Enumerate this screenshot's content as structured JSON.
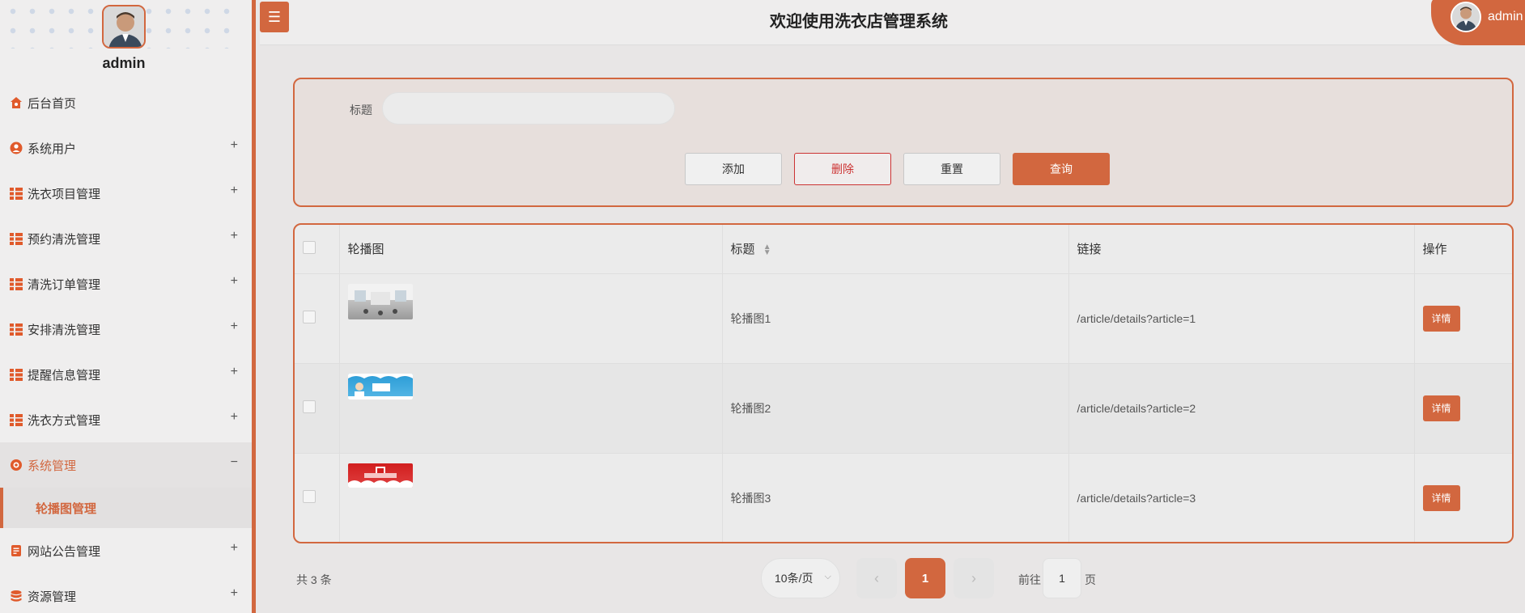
{
  "sidebar": {
    "username": "admin",
    "items": [
      {
        "label": "后台首页",
        "icon": "home-icon",
        "expand": ""
      },
      {
        "label": "系统用户",
        "icon": "user-icon",
        "expand": "+"
      },
      {
        "label": "洗衣项目管理",
        "icon": "grid-icon",
        "expand": "+"
      },
      {
        "label": "预约清洗管理",
        "icon": "grid-icon",
        "expand": "+"
      },
      {
        "label": "清洗订单管理",
        "icon": "grid-icon",
        "expand": "+"
      },
      {
        "label": "安排清洗管理",
        "icon": "grid-icon",
        "expand": "+"
      },
      {
        "label": "提醒信息管理",
        "icon": "grid-icon",
        "expand": "+"
      },
      {
        "label": "洗衣方式管理",
        "icon": "grid-icon",
        "expand": "+"
      },
      {
        "label": "系统管理",
        "icon": "gear-icon",
        "expand": "−"
      },
      {
        "label": "网站公告管理",
        "icon": "document-icon",
        "expand": "+"
      },
      {
        "label": "资源管理",
        "icon": "database-icon",
        "expand": "+"
      }
    ],
    "submenu_active": "轮播图管理",
    "accent": "#d2673f"
  },
  "header": {
    "title": "欢迎使用洗衣店管理系统",
    "toggle_icon": "☰",
    "username": "admin"
  },
  "search": {
    "label": "标题",
    "value": "",
    "buttons": {
      "add": "添加",
      "delete": "删除",
      "reset": "重置",
      "search": "查询"
    }
  },
  "table": {
    "columns": [
      "轮播图",
      "标题",
      "链接",
      "操作"
    ],
    "rows": [
      {
        "title": "轮播图1",
        "link": "/article/details?article=1",
        "action": "详情"
      },
      {
        "title": "轮播图2",
        "link": "/article/details?article=2",
        "action": "详情"
      },
      {
        "title": "轮播图3",
        "link": "/article/details?article=3",
        "action": "详情"
      }
    ]
  },
  "pagination": {
    "total": "共 3 条",
    "page_size": "10条/页",
    "current": "1",
    "goto_label": "前往",
    "goto_value": "1",
    "goto_suffix": "页"
  }
}
